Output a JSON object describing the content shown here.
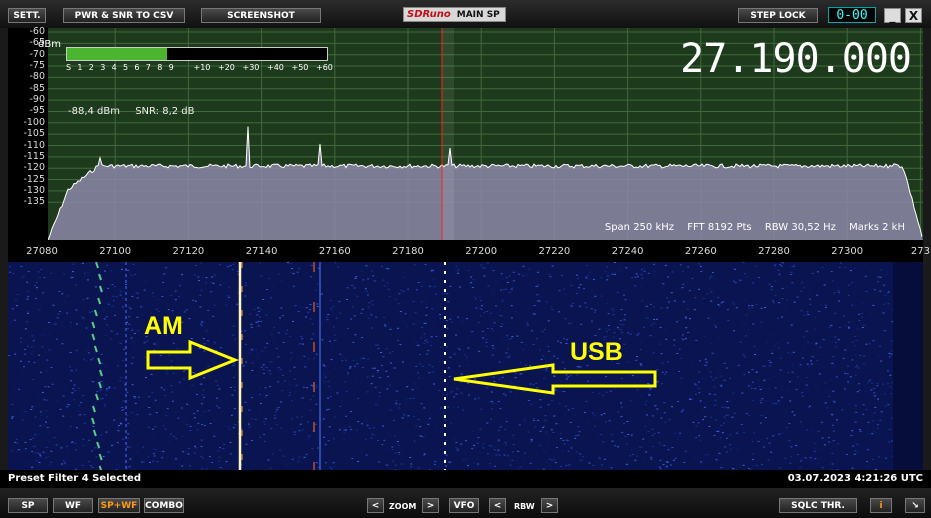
{
  "toolbar": {
    "sett_label": "SETT.",
    "pwr_snr_csv_label": "PWR & SNR TO CSV",
    "screenshot_label": "SCREENSHOT",
    "logo_text": "SDRuno",
    "window_title": "MAIN SP",
    "step_lock_label": "STEP LOCK",
    "clock_value": "0-00",
    "minimize_label": "_",
    "close_label": "X"
  },
  "spectrum": {
    "frequency_display": "27.190.000",
    "unit_label": "dBm",
    "y_labels": [
      "-60",
      "-65",
      "-70",
      "-75",
      "-80",
      "-85",
      "-90",
      "-95",
      "-100",
      "-105",
      "-110",
      "-115",
      "-120",
      "-125",
      "-130",
      "-135"
    ],
    "smeter_labels": [
      "S",
      "1",
      "2",
      "3",
      "4",
      "5",
      "6",
      "7",
      "8",
      "9",
      "+10",
      "+20",
      "+30",
      "+40",
      "+50",
      "+60"
    ],
    "smeter_level_fraction": 0.385,
    "power_readout": "-88,4 dBm",
    "snr_readout": "SNR: 8,2 dB",
    "span_info": "Span 250 kHz",
    "fft_info": "FFT 8192 Pts",
    "rbw_info": "RBW 30,52 Hz",
    "marks_info": "Marks 2 kH",
    "x_labels": [
      "27080",
      "27100",
      "27120",
      "27140",
      "27160",
      "27180",
      "27200",
      "27220",
      "27240",
      "27260",
      "27280",
      "27300",
      "273"
    ],
    "colors": {
      "background": "#1e3a1c",
      "trace_fill": "#8c87a8",
      "trace_line": "#ffffff",
      "tuning_line": "#ff2020",
      "smeter": "#4cb52f"
    }
  },
  "waterfall": {
    "annotation_am": "AM",
    "annotation_usb": "USB",
    "annotation_color": "#ffff00"
  },
  "status": {
    "message": "Preset Filter 4 Selected",
    "timestamp": "03.07.2023 4:21:26 UTC"
  },
  "bottom": {
    "sp_label": "SP",
    "wf_label": "WF",
    "spwf_label": "SP+WF",
    "combo_label": "COMBO",
    "zoom_label": "ZOOM",
    "vfo_label": "VFO",
    "rbw_label": "RBW",
    "sqlc_label": "SQLC THR.",
    "info_label": "i",
    "prev_icon": "<",
    "next_icon": ">",
    "resize_icon": "↘"
  }
}
